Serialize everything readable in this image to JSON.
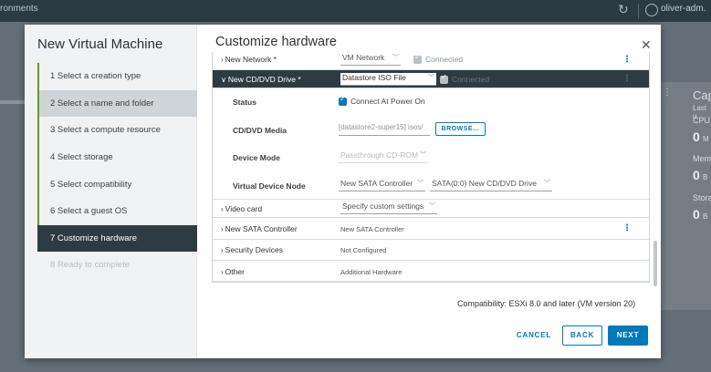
{
  "background": {
    "breadcrumb": "ronments",
    "user": "oliver-adm.",
    "card_title": "Cap",
    "card_last": "Last u",
    "cpu_label": "CPU",
    "cpu_value": "0",
    "cpu_unit": "M",
    "mem_label": "Mem",
    "mem_value": "0",
    "mem_unit": "B",
    "stor_label": "Stora",
    "stor_value": "0",
    "stor_unit": "B"
  },
  "wizard": {
    "title": "New Virtual Machine",
    "steps": [
      {
        "label": "1   Select a creation type"
      },
      {
        "label": "2   Select a name and folder"
      },
      {
        "label": "3   Select a compute resource"
      },
      {
        "label": "4   Select storage"
      },
      {
        "label": "5   Select compatibility"
      },
      {
        "label": "6   Select a guest OS"
      },
      {
        "label": "7   Customize hardware"
      },
      {
        "label": "8   Ready to complete"
      }
    ]
  },
  "main": {
    "title": "Customize hardware",
    "rows": {
      "network": {
        "label": "New Network *",
        "value": "VM Network",
        "connected": "Connected"
      },
      "cd": {
        "label": "New CD/DVD Drive *",
        "value": "Datastore ISO File",
        "connected": "Connected"
      },
      "status": {
        "label": "Status",
        "value": "Connect At Power On"
      },
      "media": {
        "label": "CD/DVD Media",
        "value": "[datastore2-super15] isos/",
        "browse": "BROWSE..."
      },
      "mode": {
        "label": "Device Mode",
        "value": "Passthrough CD-ROM"
      },
      "node": {
        "label": "Virtual Device Node",
        "controller": "New SATA Controller",
        "slot": "SATA(0:0) New CD/DVD Drive"
      },
      "video": {
        "label": "Video card",
        "value": "Specify custom settings"
      },
      "sata": {
        "label": "New SATA Controller",
        "value": "New SATA Controller"
      },
      "security": {
        "label": "Security Devices",
        "value": "Not Configured"
      },
      "other": {
        "label": "Other",
        "value": "Additional Hardware"
      }
    },
    "compatibility": "Compatibility: ESXi 8.0 and later (VM version 20)",
    "buttons": {
      "cancel": "CANCEL",
      "back": "BACK",
      "next": "NEXT"
    }
  },
  "colors": {
    "accent": "#0079b8",
    "complete": "#5aa220",
    "current_step_bg": "#2e3b42"
  }
}
